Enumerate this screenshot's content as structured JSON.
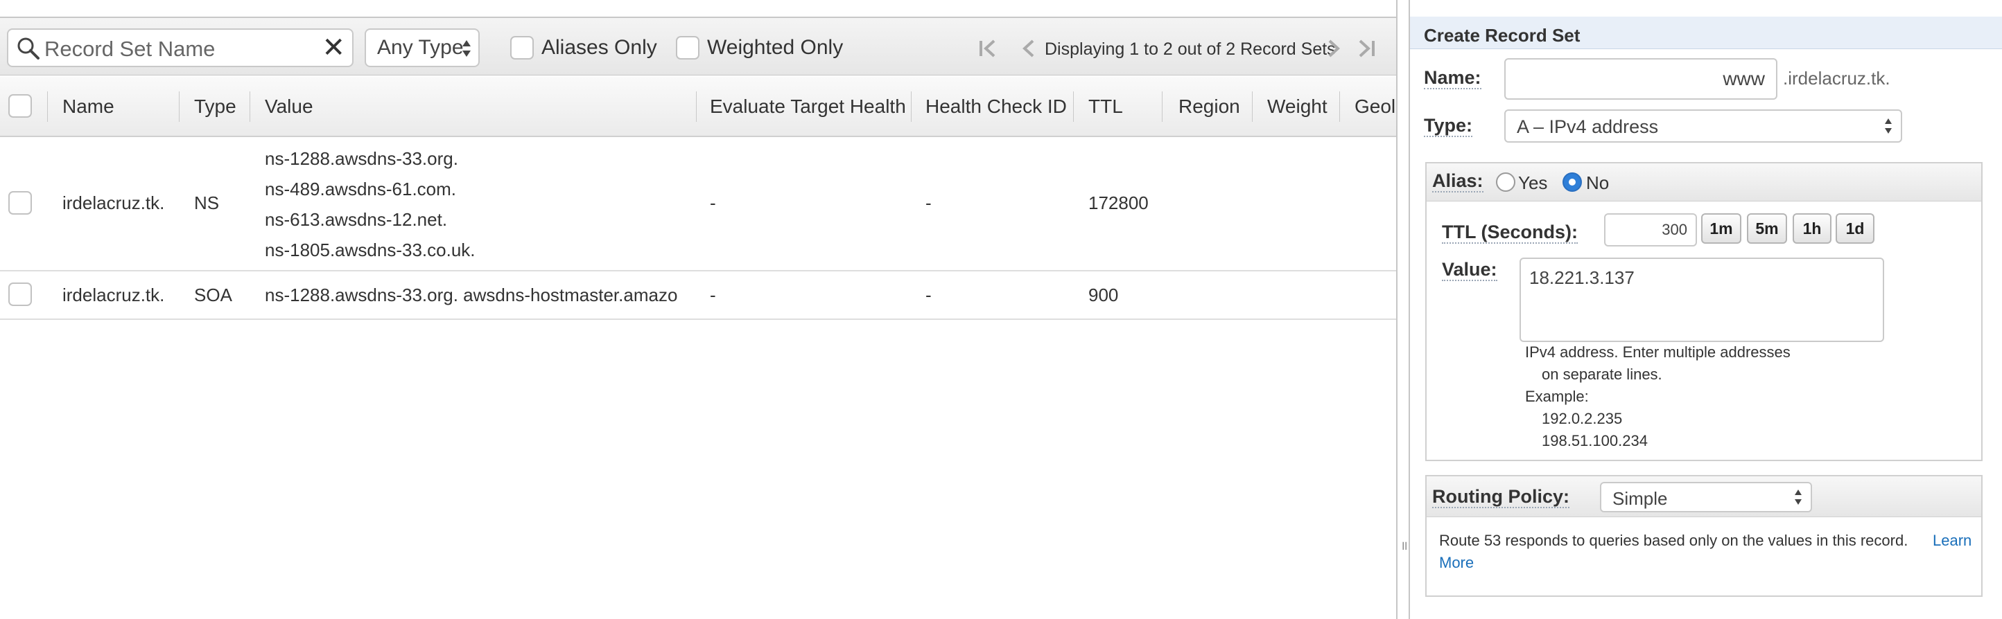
{
  "toolbar": {
    "search_placeholder": "Record Set Name",
    "clear_glyph": "✕",
    "type_filter": "Any Type",
    "aliases_only": "Aliases Only",
    "weighted_only": "Weighted Only",
    "pager_text": "Displaying 1 to 2 out of 2 Record Sets"
  },
  "grid": {
    "columns": [
      "Name",
      "Type",
      "Value",
      "Evaluate Target Health",
      "Health Check ID",
      "TTL",
      "Region",
      "Weight",
      "Geolc"
    ],
    "rows": [
      {
        "name": "irdelacruz.tk.",
        "type": "NS",
        "values": [
          "ns-1288.awsdns-33.org.",
          "ns-489.awsdns-61.com.",
          "ns-613.awsdns-12.net.",
          "ns-1805.awsdns-33.co.uk."
        ],
        "evaluate": "-",
        "health": "-",
        "ttl": "172800"
      },
      {
        "name": "irdelacruz.tk.",
        "type": "SOA",
        "values": [
          "ns-1288.awsdns-33.org. awsdns-hostmaster.amazo"
        ],
        "evaluate": "-",
        "health": "-",
        "ttl": "900"
      }
    ]
  },
  "panel": {
    "title": "Create Record Set",
    "name_label": "Name:",
    "name_value": "www",
    "domain_suffix": ".irdelacruz.tk.",
    "type_label": "Type:",
    "type_value": "A – IPv4 address",
    "alias_label": "Alias:",
    "alias_yes": "Yes",
    "alias_no": "No",
    "ttl_label": "TTL (Seconds):",
    "ttl_value": "300",
    "ttl_buttons": [
      "1m",
      "5m",
      "1h",
      "1d"
    ],
    "value_label": "Value:",
    "value_text": "18.221.3.137",
    "help_lines": [
      "IPv4 address. Enter multiple addresses",
      "on separate lines.",
      "Example:",
      "192.0.2.235",
      "198.51.100.234"
    ],
    "routing_label": "Routing Policy:",
    "routing_value": "Simple",
    "routing_help": "Route 53 responds to queries based only on the values in this record.",
    "learn_more_1": "Learn",
    "learn_more_2": "More"
  },
  "splitter_glyph": "॥",
  "colors": {
    "accent": "#2f7fd8",
    "link": "#1a6fba",
    "panel_title_bg": "#e8eff8"
  }
}
